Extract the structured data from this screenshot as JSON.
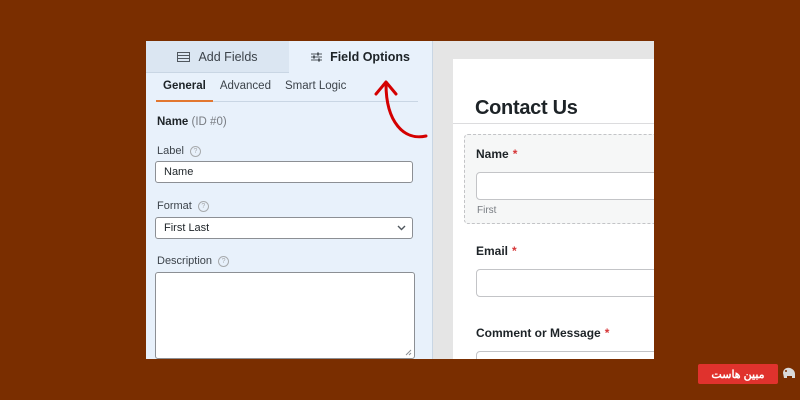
{
  "panel": {
    "tabs": [
      {
        "label": "Add Fields",
        "icon": "table-icon"
      },
      {
        "label": "Field Options",
        "icon": "sliders-icon",
        "active": true
      }
    ],
    "subtabs": [
      "General",
      "Advanced",
      "Smart Logic"
    ],
    "active_subtab": "General",
    "field_name": "Name",
    "field_id": "(ID #0)",
    "label_caption": "Label",
    "label_value": "Name",
    "format_caption": "Format",
    "format_value": "First Last",
    "description_caption": "Description",
    "help_glyph": "?"
  },
  "preview": {
    "form_title": "Contact Us",
    "fields": [
      {
        "label": "Name",
        "required": "*",
        "sublabel": "First"
      },
      {
        "label": "Email",
        "required": "*"
      },
      {
        "label": "Comment or Message",
        "required": "*"
      }
    ]
  },
  "watermark": {
    "text": "مبین هاست"
  },
  "colors": {
    "background": "#7a2e00",
    "panel": "#e8f1fb",
    "accent": "#e27730",
    "annotation": "#d40000",
    "required": "#d63638",
    "watermark": "#e0322d"
  }
}
